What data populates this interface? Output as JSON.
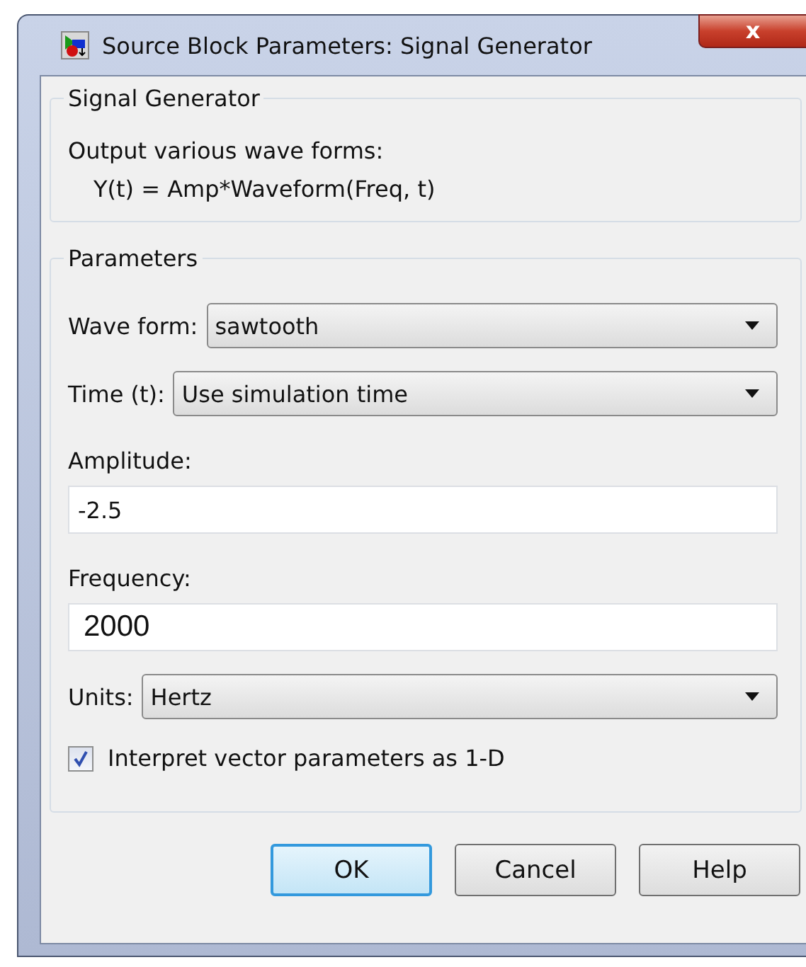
{
  "window": {
    "title": "Source Block Parameters: Signal Generator",
    "close_label": "x"
  },
  "description": {
    "title": "Signal Generator",
    "lines": [
      "Output various wave forms:",
      "Y(t) = Amp*Waveform(Freq, t)"
    ]
  },
  "parameters": {
    "title": "Parameters",
    "items": [
      {
        "kind": "dropdown",
        "label": "Wave form:",
        "value": "sawtooth"
      },
      {
        "kind": "dropdown",
        "label": "Time (t):",
        "value": "Use simulation time"
      },
      {
        "kind": "text",
        "label": "Amplitude:",
        "value": "-2.5",
        "large": false
      },
      {
        "kind": "text",
        "label": "Frequency:",
        "value": "2000",
        "large": true
      },
      {
        "kind": "dropdown",
        "label": "Units:",
        "value": "Hertz"
      },
      {
        "kind": "checkbox",
        "label": "Interpret vector parameters as 1-D",
        "checked": true
      }
    ]
  },
  "buttons": [
    {
      "label": "OK",
      "focused": true
    },
    {
      "label": "Cancel",
      "focused": false
    },
    {
      "label": "Help",
      "focused": false
    }
  ]
}
